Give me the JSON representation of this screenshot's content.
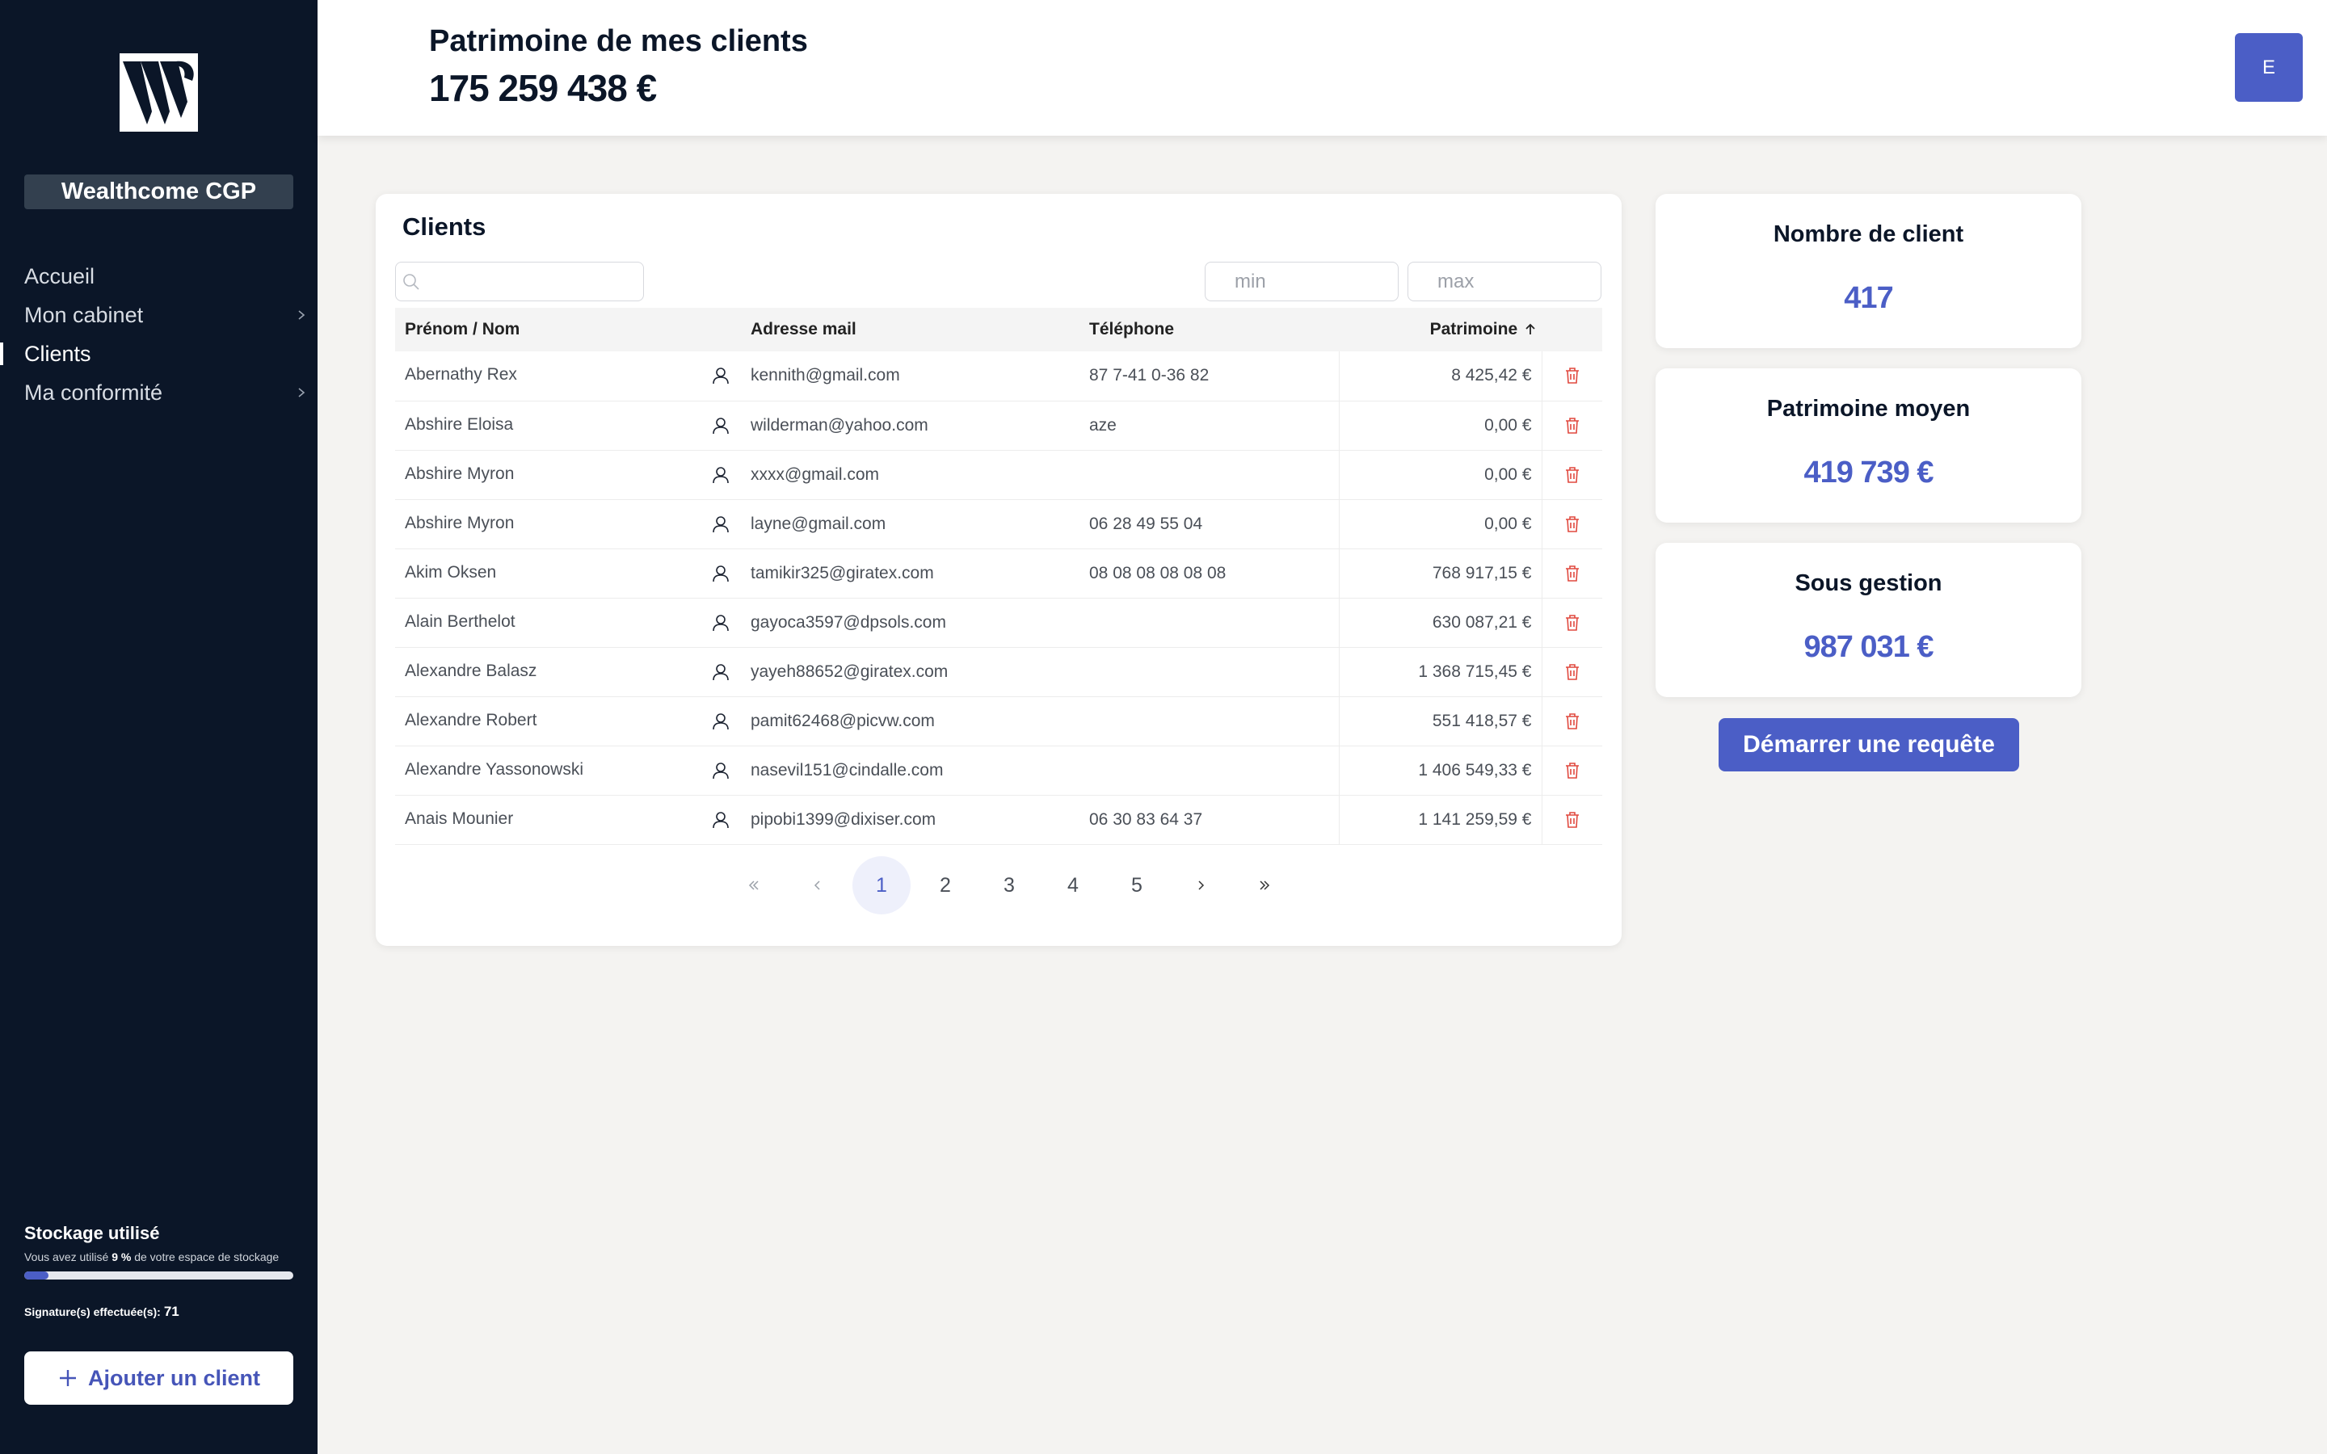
{
  "app": {
    "brand": "Wealthcome CGP",
    "logo_icon": "w-logo-icon"
  },
  "sidebar": {
    "items": [
      {
        "label": "Accueil",
        "active": false,
        "has_submenu": false
      },
      {
        "label": "Mon cabinet",
        "active": false,
        "has_submenu": true
      },
      {
        "label": "Clients",
        "active": true,
        "has_submenu": false
      },
      {
        "label": "Ma conformité",
        "active": false,
        "has_submenu": true
      }
    ],
    "storage": {
      "title": "Stockage utilisé",
      "desc_prefix": "Vous avez utilisé",
      "percent_label": "9 %",
      "desc_suffix": "de votre espace de stockage",
      "fraction": 0.09
    },
    "signatures": {
      "label": "Signature(s) effectuée(s):",
      "count": "71"
    },
    "add_client_label": "Ajouter un client"
  },
  "header": {
    "title": "Patrimoine de mes clients",
    "value": "175 259 438 €",
    "avatar_initial": "E"
  },
  "clients": {
    "title": "Clients",
    "search_placeholder": "",
    "min_placeholder": "min",
    "max_placeholder": "max",
    "columns": {
      "name": "Prénom / Nom",
      "email": "Adresse mail",
      "phone": "Téléphone",
      "patrimoine": "Patrimoine"
    },
    "sort": {
      "column": "patrimoine",
      "direction": "asc"
    },
    "rows": [
      {
        "name": "Abernathy Rex",
        "email": "kennith@gmail.com",
        "phone": "87 7-41 0-36 82",
        "patrimoine": "8 425,42 €"
      },
      {
        "name": "Abshire Eloisa",
        "email": "wilderman@yahoo.com",
        "phone": "aze",
        "patrimoine": "0,00 €"
      },
      {
        "name": "Abshire Myron",
        "email": "xxxx@gmail.com",
        "phone": "",
        "patrimoine": "0,00 €"
      },
      {
        "name": "Abshire Myron",
        "email": "layne@gmail.com",
        "phone": "06 28 49 55 04",
        "patrimoine": "0,00 €"
      },
      {
        "name": "Akim Oksen",
        "email": "tamikir325@giratex.com",
        "phone": "08 08 08 08 08 08",
        "patrimoine": "768 917,15 €"
      },
      {
        "name": "Alain Berthelot",
        "email": "gayoca3597@dpsols.com",
        "phone": "",
        "patrimoine": "630 087,21 €"
      },
      {
        "name": "Alexandre Balasz",
        "email": "yayeh88652@giratex.com",
        "phone": "",
        "patrimoine": "1 368 715,45 €"
      },
      {
        "name": "Alexandre Robert",
        "email": "pamit62468@picvw.com",
        "phone": "",
        "patrimoine": "551 418,57 €"
      },
      {
        "name": "Alexandre Yassonowski",
        "email": "nasevil151@cindalle.com",
        "phone": "",
        "patrimoine": "1 406 549,33 €"
      },
      {
        "name": "Anais Mounier",
        "email": "pipobi1399@dixiser.com",
        "phone": "06 30 83 64 37",
        "patrimoine": "1 141 259,59 €"
      }
    ],
    "pagination": {
      "pages": [
        "1",
        "2",
        "3",
        "4",
        "5"
      ],
      "current": "1"
    }
  },
  "stats": [
    {
      "label": "Nombre de client",
      "value": "417"
    },
    {
      "label": "Patrimoine moyen",
      "value": "419 739 €"
    },
    {
      "label": "Sous gestion",
      "value": "987 031 €"
    }
  ],
  "request_button_label": "Démarrer une requête",
  "colors": {
    "sidebar_bg": "#0b1628",
    "accent": "#4b5ec6",
    "delete": "#e0483e",
    "page_bg": "#f4f3f1"
  }
}
